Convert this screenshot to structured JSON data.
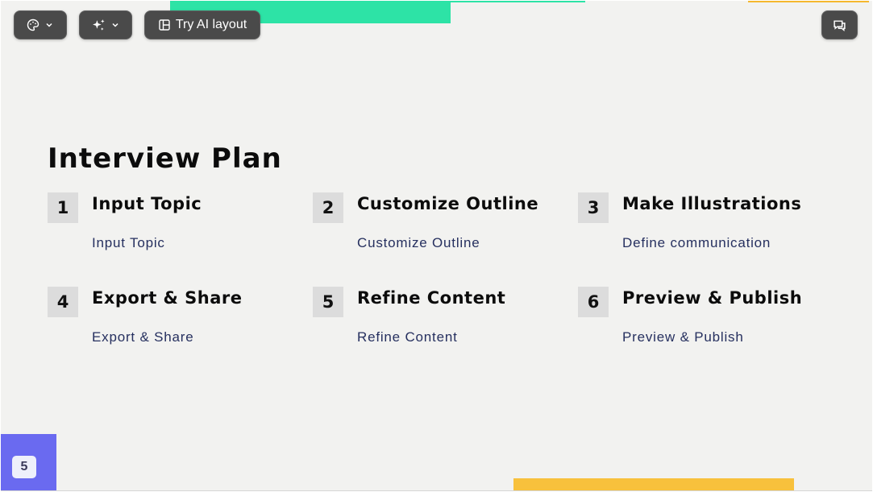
{
  "toolbar": {
    "theme_icon": "palette-icon",
    "ai_icon": "sparkles-icon",
    "layout_icon": "layout-icon",
    "layout_label": "Try AI layout",
    "chat_icon": "chat-icon",
    "chevron_icon": "chevron-down-icon"
  },
  "slide": {
    "title": "Interview Plan",
    "page_number": "5",
    "steps": [
      {
        "number": "1",
        "title": "Input Topic",
        "description": "Input Topic"
      },
      {
        "number": "2",
        "title": "Customize Outline",
        "description": "Customize Outline"
      },
      {
        "number": "3",
        "title": "Make Illustrations",
        "description": "Define communication"
      },
      {
        "number": "4",
        "title": "Export & Share",
        "description": "Export & Share"
      },
      {
        "number": "5",
        "title": "Refine Content",
        "description": "Refine Content"
      },
      {
        "number": "6",
        "title": "Preview & Publish",
        "description": "Preview & Publish"
      }
    ]
  },
  "colors": {
    "background": "#f2f2f0",
    "accent_green": "#2de3a6",
    "accent_yellow": "#f8c13c",
    "accent_purple": "#6a6af0",
    "description_text": "#26305f",
    "toolbar_button": "#4a4a4a"
  }
}
